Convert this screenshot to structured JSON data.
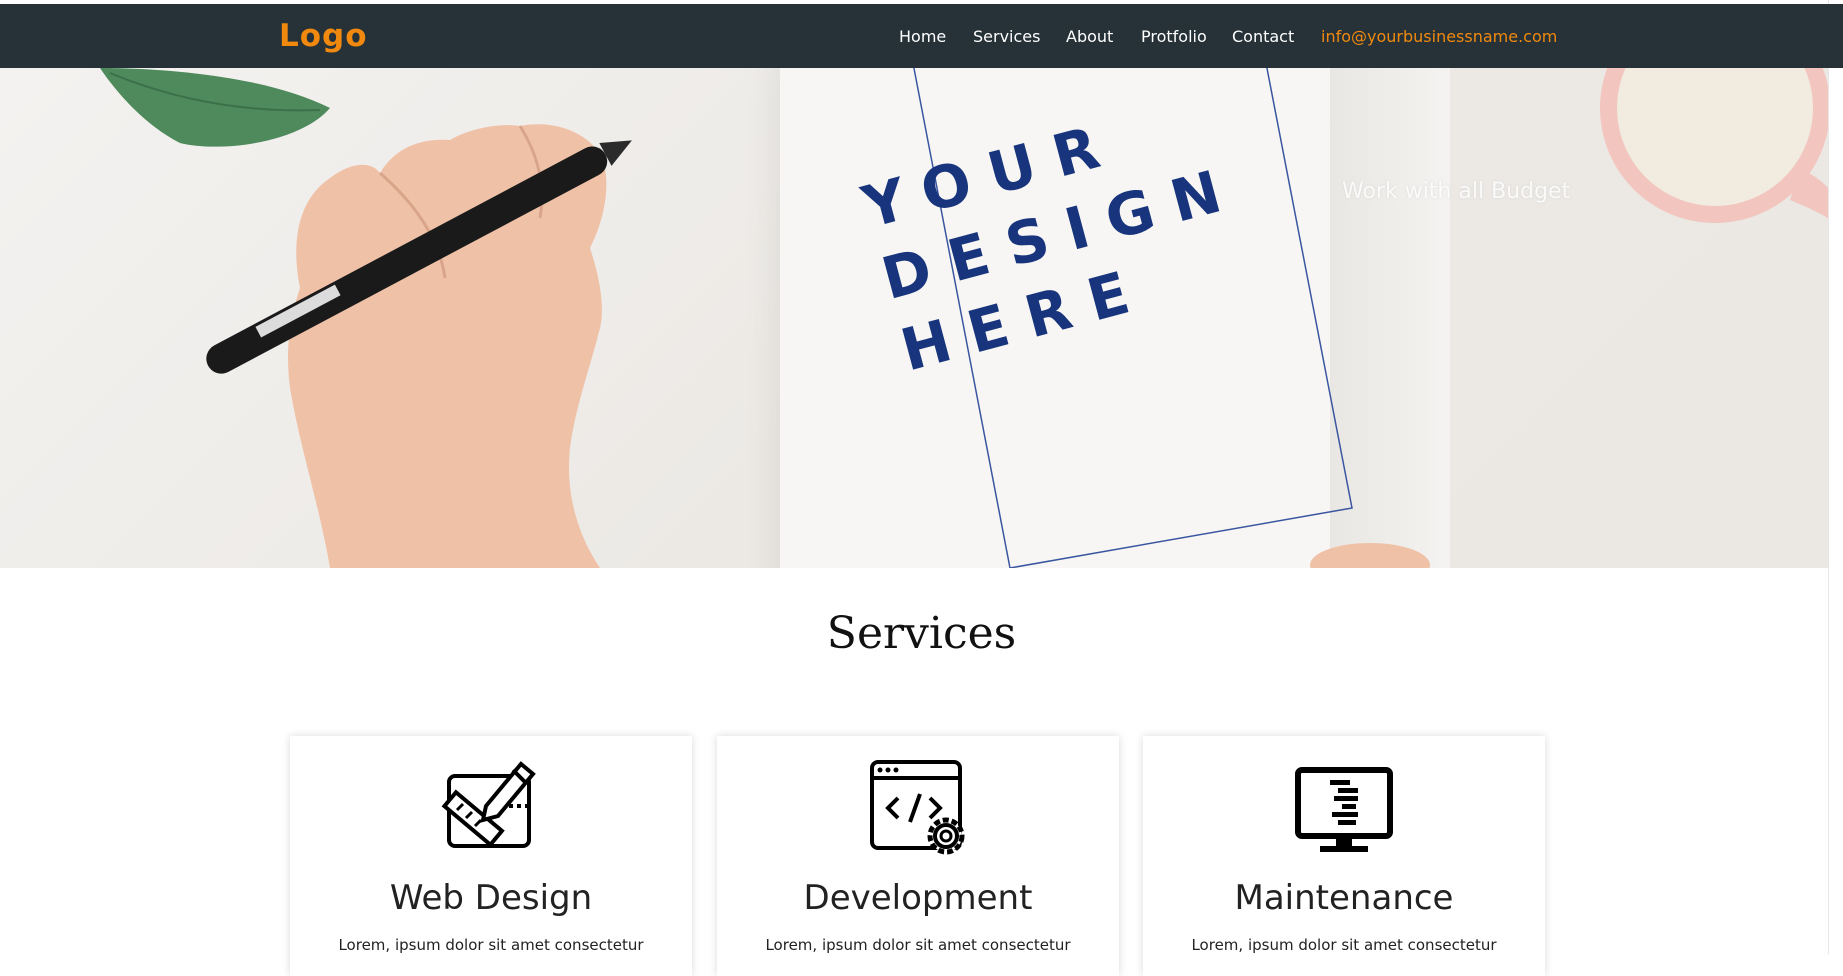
{
  "navbar": {
    "logo": "Logo",
    "links": [
      "Home",
      "Services",
      "About",
      "Protfolio",
      "Contact"
    ],
    "email": "info@yourbusinessname.com"
  },
  "hero": {
    "design_text": [
      "YOUR",
      "DESIGN",
      "HERE"
    ],
    "tagline": "Work with all Budget"
  },
  "services": {
    "title": "Services",
    "cards": [
      {
        "title": "Web Design",
        "text": "Lorem, ipsum dolor sit amet consectetur",
        "icon": "design-tools-icon"
      },
      {
        "title": "Development",
        "text": "Lorem, ipsum dolor sit amet consectetur",
        "icon": "code-gear-icon"
      },
      {
        "title": "Maintenance",
        "text": "Lorem, ipsum dolor sit amet consectetur",
        "icon": "monitor-icon"
      }
    ]
  },
  "colors": {
    "navbar_bg": "#263238",
    "accent": "#f0890e",
    "design_text": "#17347c"
  }
}
